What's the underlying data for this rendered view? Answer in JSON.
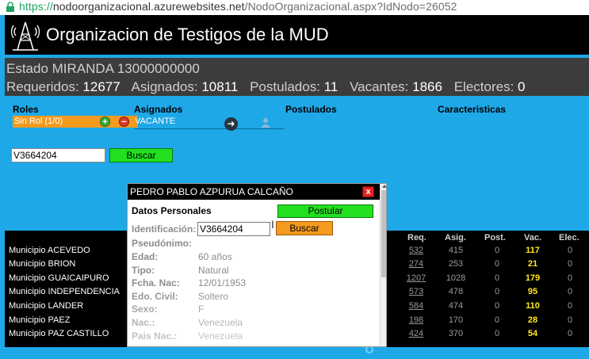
{
  "browser": {
    "url_scheme": "https://",
    "url_host": "nodoorganizacional.azurewebsites.net",
    "url_path": "/NodoOrganizacional.aspx?IdNodo=26052"
  },
  "header": {
    "title": "Organizacion de Testigos de la MUD",
    "logo_icon": "tower-logo-icon"
  },
  "stats": {
    "estado": "Estado MIRANDA 13000000000",
    "requeridos_label": "Requeridos:",
    "requeridos": "12677",
    "asignados_label": "Asignados:",
    "asignados": "10811",
    "postulados_label": "Postulados:",
    "postulados": "11",
    "vacantes_label": "Vacantes:",
    "vacantes": "1866",
    "electores_label": "Electores:",
    "electores": "0"
  },
  "panel": {
    "col_roles": "Roles",
    "col_asignados": "Asignados",
    "col_postulados": "Postulados",
    "col_caracteristicas": "Caracteristicas",
    "role_label": "Sin Rol (1/0)",
    "asignado_label": "VACANTE",
    "plus_icon": "+",
    "minus_icon": "−",
    "arrow_icon": "➜",
    "search_value": "V3664204",
    "search_button": "Buscar"
  },
  "table": {
    "headers": {
      "req": "Req.",
      "asig": "Asig.",
      "post": "Post.",
      "vac": "Vac.",
      "elec": "Elec."
    },
    "rows": [
      {
        "municipio": "Municipio ACEVEDO",
        "req": "532",
        "asig": "415",
        "post": "0",
        "vac": "117",
        "elec": "0"
      },
      {
        "municipio": "Municipio BRION",
        "req": "274",
        "asig": "253",
        "post": "0",
        "vac": "21",
        "elec": "0"
      },
      {
        "municipio": "Municipio GUAICAIPURO",
        "req": "1207",
        "asig": "1028",
        "post": "0",
        "vac": "179",
        "elec": "0"
      },
      {
        "municipio": "Municipio INDEPENDENCIA",
        "req": "573",
        "asig": "478",
        "post": "0",
        "vac": "95",
        "elec": "0"
      },
      {
        "municipio": "Municipio LANDER",
        "req": "584",
        "asig": "474",
        "post": "0",
        "vac": "110",
        "elec": "0"
      },
      {
        "municipio": "Municipio PAEZ",
        "req": "198",
        "asig": "170",
        "post": "0",
        "vac": "28",
        "elec": "0"
      },
      {
        "municipio": "Municipio PAZ CASTILLO",
        "req": "424",
        "asig": "370",
        "post": "0",
        "vac": "54",
        "elec": "0"
      }
    ]
  },
  "modal": {
    "title": "PEDRO PABLO AZPURUA CALCAÑO",
    "close_label": "x",
    "section": "Datos Personales",
    "postular_button": "Postular",
    "buscar_button": "Buscar",
    "fields": [
      {
        "label": "Identificación:",
        "value": ""
      },
      {
        "label": "Pseudónimo:",
        "value": ""
      },
      {
        "label": "Edad:",
        "value": "60 años"
      },
      {
        "label": "Tipo:",
        "value": "Natural"
      },
      {
        "label": "Fcha. Nac:",
        "value": "12/01/1953"
      },
      {
        "label": "Edo. Civil:",
        "value": "Soltero"
      },
      {
        "label": "Sexo:",
        "value": "F"
      },
      {
        "label": "Nac.:",
        "value": "Venezuela"
      },
      {
        "label": "Pais Nac.:",
        "value": "Venezuela"
      }
    ],
    "id_value": "V3664204"
  },
  "colors": {
    "accent_blue": "#1ea8e8",
    "header_black": "#000000",
    "orange": "#f49a1e",
    "green": "#22e020",
    "vac_yellow": "#ffe91f"
  }
}
